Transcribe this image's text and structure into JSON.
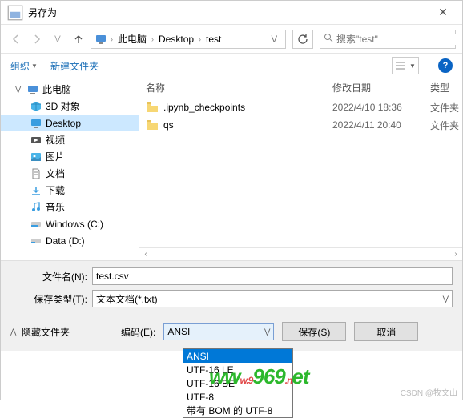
{
  "window": {
    "title": "另存为",
    "close": "✕"
  },
  "breadcrumb": {
    "items": [
      "此电脑",
      "Desktop",
      "test"
    ]
  },
  "search": {
    "placeholder": "搜索\"test\""
  },
  "toolbar": {
    "organize": "组织",
    "new_folder": "新建文件夹"
  },
  "columns": {
    "name": "名称",
    "date": "修改日期",
    "type": "类型"
  },
  "sidebar": {
    "items": [
      {
        "label": "此电脑",
        "icon": "pc",
        "has_children": true
      },
      {
        "label": "3D 对象",
        "icon": "3d"
      },
      {
        "label": "Desktop",
        "icon": "desktop",
        "selected": true
      },
      {
        "label": "视频",
        "icon": "video"
      },
      {
        "label": "图片",
        "icon": "pictures"
      },
      {
        "label": "文档",
        "icon": "documents"
      },
      {
        "label": "下载",
        "icon": "downloads"
      },
      {
        "label": "音乐",
        "icon": "music"
      },
      {
        "label": "Windows (C:)",
        "icon": "drive"
      },
      {
        "label": "Data (D:)",
        "icon": "drive"
      }
    ]
  },
  "files": [
    {
      "name": ".ipynb_checkpoints",
      "date": "2022/4/10 18:36",
      "type": "文件夹"
    },
    {
      "name": "qs",
      "date": "2022/4/11 20:40",
      "type": "文件夹"
    }
  ],
  "fields": {
    "filename_label": "文件名(N):",
    "filename_value": "test.csv",
    "filetype_label": "保存类型(T):",
    "filetype_value": "文本文档(*.txt)"
  },
  "encoding": {
    "label": "编码(E):",
    "value": "ANSI",
    "options": [
      "ANSI",
      "UTF-16 LE",
      "UTF-16 BE",
      "UTF-8",
      "带有 BOM 的 UTF-8"
    ]
  },
  "buttons": {
    "hide_folders": "隐藏文件夹",
    "save": "保存(S)",
    "cancel": "取消"
  },
  "watermark": {
    "text": "www.9969.net"
  },
  "attribution": "CSDN @牧文山"
}
